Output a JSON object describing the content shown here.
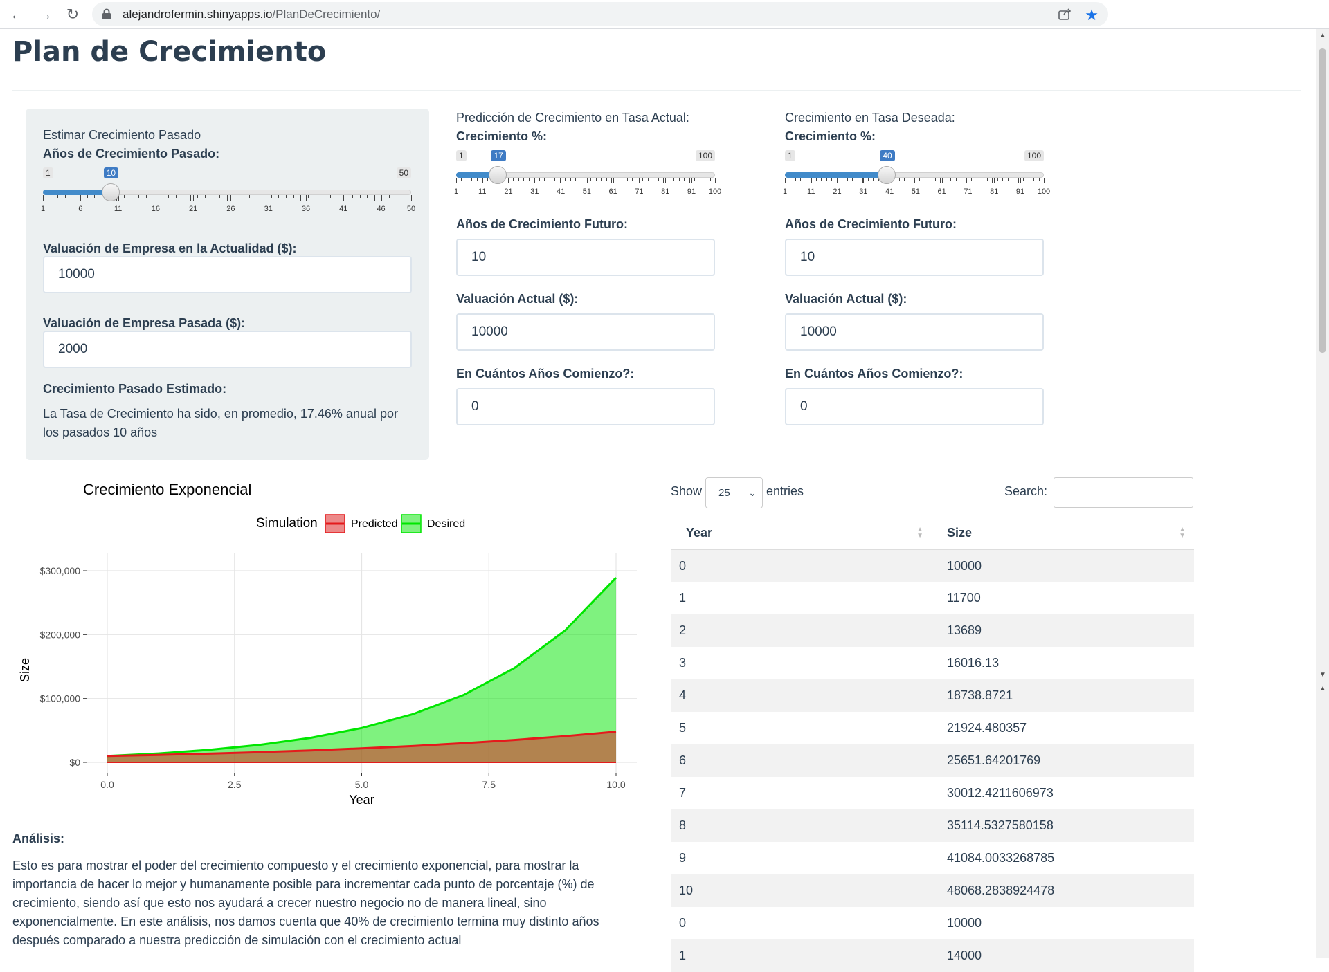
{
  "browser": {
    "url_host": "alejandrofermin.shinyapps.io",
    "url_path": "/PlanDeCrecimiento/"
  },
  "page": {
    "title": "Plan de Crecimiento"
  },
  "past": {
    "section_label": "Estimar Crecimiento Pasado",
    "years_label": "Años de Crecimiento Pasado:",
    "slider": {
      "min": 1,
      "max": 50,
      "value": 10,
      "ticks": [
        "1",
        "6",
        "11",
        "16",
        "21",
        "26",
        "31",
        "36",
        "41",
        "46",
        "50"
      ]
    },
    "current_value_label": "Valuación de Empresa en la Actualidad ($):",
    "current_value": "10000",
    "past_value_label": "Valuación de Empresa Pasada ($):",
    "past_value": "2000",
    "estimate_label": "Crecimiento Pasado Estimado:",
    "estimate_text": "La Tasa de Crecimiento ha sido, en promedio, 17.46% anual por los pasados 10 años"
  },
  "predicted": {
    "section_label": "Predicción de Crecimiento en Tasa Actual:",
    "growth_label": "Crecimiento %:",
    "slider": {
      "min": 1,
      "max": 100,
      "value": 17,
      "ticks": [
        "1",
        "11",
        "21",
        "31",
        "41",
        "51",
        "61",
        "71",
        "81",
        "91",
        "100"
      ]
    },
    "years_label": "Años de Crecimiento Futuro:",
    "years": "10",
    "value_label": "Valuación Actual ($):",
    "value": "10000",
    "start_label": "En Cuántos Años Comienzo?:",
    "start": "0"
  },
  "desired": {
    "section_label": "Crecimiento en Tasa Deseada:",
    "growth_label": "Crecimiento %:",
    "slider": {
      "min": 1,
      "max": 100,
      "value": 40,
      "ticks": [
        "1",
        "11",
        "21",
        "31",
        "41",
        "51",
        "61",
        "71",
        "81",
        "91",
        "100"
      ]
    },
    "years_label": "Años de Crecimiento Futuro:",
    "years": "10",
    "value_label": "Valuación Actual ($):",
    "value": "10000",
    "start_label": "En Cuántos Años Comienzo?:",
    "start": "0"
  },
  "chart_data": {
    "type": "area",
    "title": "Crecimiento Exponencial",
    "xlabel": "Year",
    "ylabel": "Size",
    "legend_title": "Simulation",
    "legend_position": "top",
    "x": [
      0,
      1,
      2,
      3,
      4,
      5,
      6,
      7,
      8,
      9,
      10
    ],
    "xlim": [
      0,
      10
    ],
    "ylim": [
      0,
      300000
    ],
    "xticks": [
      "0.0",
      "2.5",
      "5.0",
      "7.5",
      "10.0"
    ],
    "yticks": [
      "$0",
      "$100,000",
      "$200,000",
      "$300,000"
    ],
    "grid": true,
    "series": [
      {
        "name": "Predicted",
        "color": "#e41a1c",
        "fill": "rgba(220,40,40,0.55)",
        "values": [
          10000,
          11700,
          13689,
          16016.13,
          18738.87,
          21924.48,
          25651.64,
          30012.42,
          35114.53,
          41084.0,
          48068.28
        ]
      },
      {
        "name": "Desired",
        "color": "#00e600",
        "fill": "rgba(0,230,0,0.5)",
        "values": [
          10000,
          14000,
          19600,
          27440,
          38416,
          53782,
          75295,
          105414,
          147579,
          206610,
          289255
        ]
      }
    ]
  },
  "analysis": {
    "heading": "Análisis:",
    "text": "Esto es para mostrar el poder del crecimiento compuesto y el crecimiento exponencial, para mostrar la importancia de hacer lo mejor y humanamente posible para incrementar cada punto de porcentaje (%) de crecimiento, siendo así que esto nos ayudará a crecer nuestro negocio no de manera lineal, sino exponencialmente. En este análisis, nos damos cuenta que 40% de crecimiento termina muy distinto años después comparado a nuestra predicción de simulación con el crecimiento actual"
  },
  "table": {
    "show_label": "Show",
    "page_size": "25",
    "entries_label": "entries",
    "search_label": "Search:",
    "columns": [
      "Year",
      "Size"
    ],
    "rows": [
      [
        "0",
        "10000"
      ],
      [
        "1",
        "11700"
      ],
      [
        "2",
        "13689"
      ],
      [
        "3",
        "16016.13"
      ],
      [
        "4",
        "18738.8721"
      ],
      [
        "5",
        "21924.480357"
      ],
      [
        "6",
        "25651.64201769"
      ],
      [
        "7",
        "30012.4211606973"
      ],
      [
        "8",
        "35114.5327580158"
      ],
      [
        "9",
        "41084.0033268785"
      ],
      [
        "10",
        "48068.2838924478"
      ],
      [
        "0",
        "10000"
      ],
      [
        "1",
        "14000"
      ]
    ]
  }
}
